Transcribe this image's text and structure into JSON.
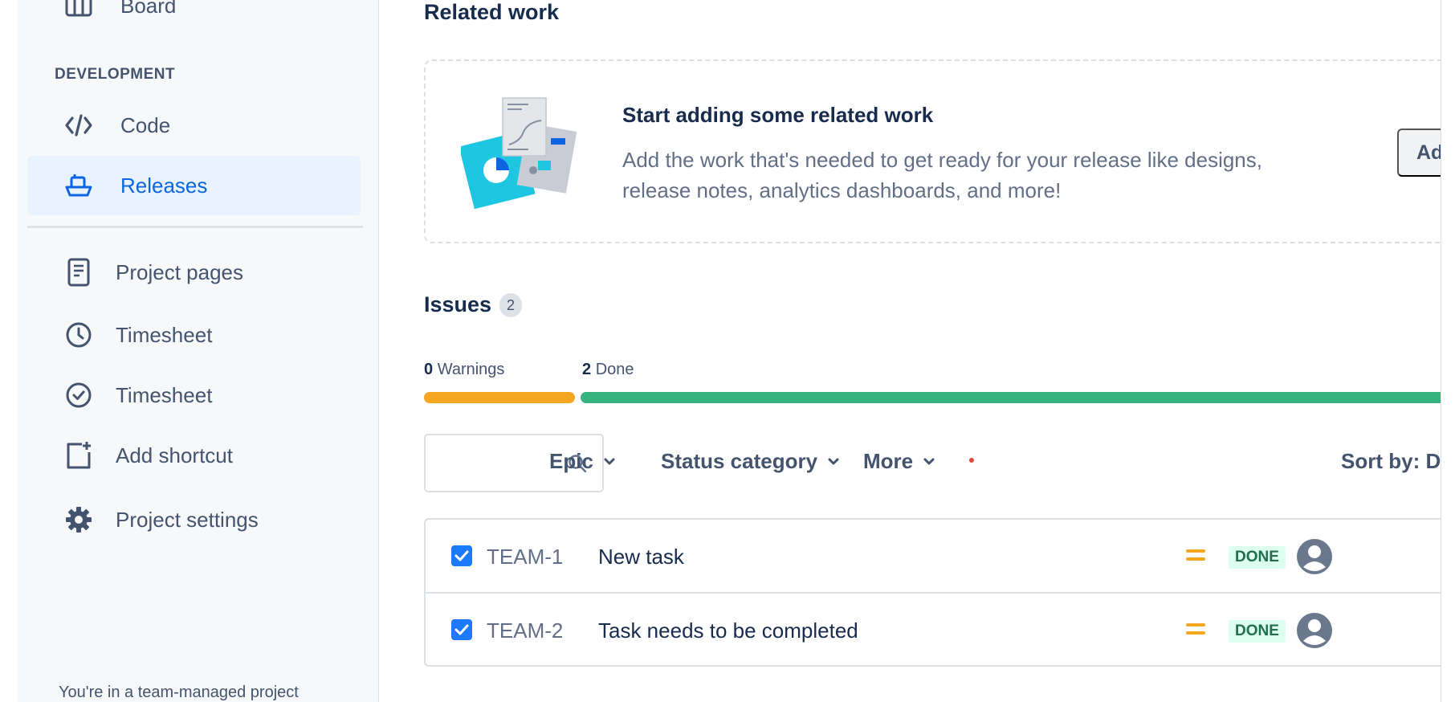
{
  "sidebar": {
    "board_label": "Board",
    "section_development": "DEVELOPMENT",
    "items": [
      {
        "label": "Code",
        "icon": "code-icon"
      },
      {
        "label": "Releases",
        "icon": "ship-icon",
        "active": true
      },
      {
        "label": "Project pages",
        "icon": "page-icon"
      },
      {
        "label": "Timesheet",
        "icon": "clock-icon"
      },
      {
        "label": "Timesheet",
        "icon": "check-circle-icon"
      },
      {
        "label": "Add shortcut",
        "icon": "add-shortcut-icon"
      },
      {
        "label": "Project settings",
        "icon": "gear-icon"
      }
    ],
    "footer": "You're in a team-managed project"
  },
  "related": {
    "heading": "Related work",
    "title": "Start adding some related work",
    "description": "Add the work that's needed to get ready for your release like designs, release notes, analytics dashboards, and more!",
    "add_button": "Add related work"
  },
  "issues": {
    "heading": "Issues",
    "count": "2",
    "warnings_count": "0",
    "warnings_label": "Warnings",
    "done_count": "2",
    "done_label": "Done",
    "done_fraction": 1.0,
    "filters": {
      "epic": "Epic",
      "status_category": "Status category",
      "more": "More",
      "sort_by": "Sort by: Date"
    },
    "rows": [
      {
        "key": "TEAM-1",
        "summary": "New task",
        "status": "DONE"
      },
      {
        "key": "TEAM-2",
        "summary": "Task needs to be completed",
        "status": "DONE"
      }
    ]
  },
  "colors": {
    "accent": "#0c66e4",
    "warning_bar": "#f5a623",
    "done_bar": "#36b37e",
    "priority_medium": "#f5a623",
    "done_lozenge_bg": "#dcfff1",
    "done_lozenge_text": "#216e4e"
  }
}
